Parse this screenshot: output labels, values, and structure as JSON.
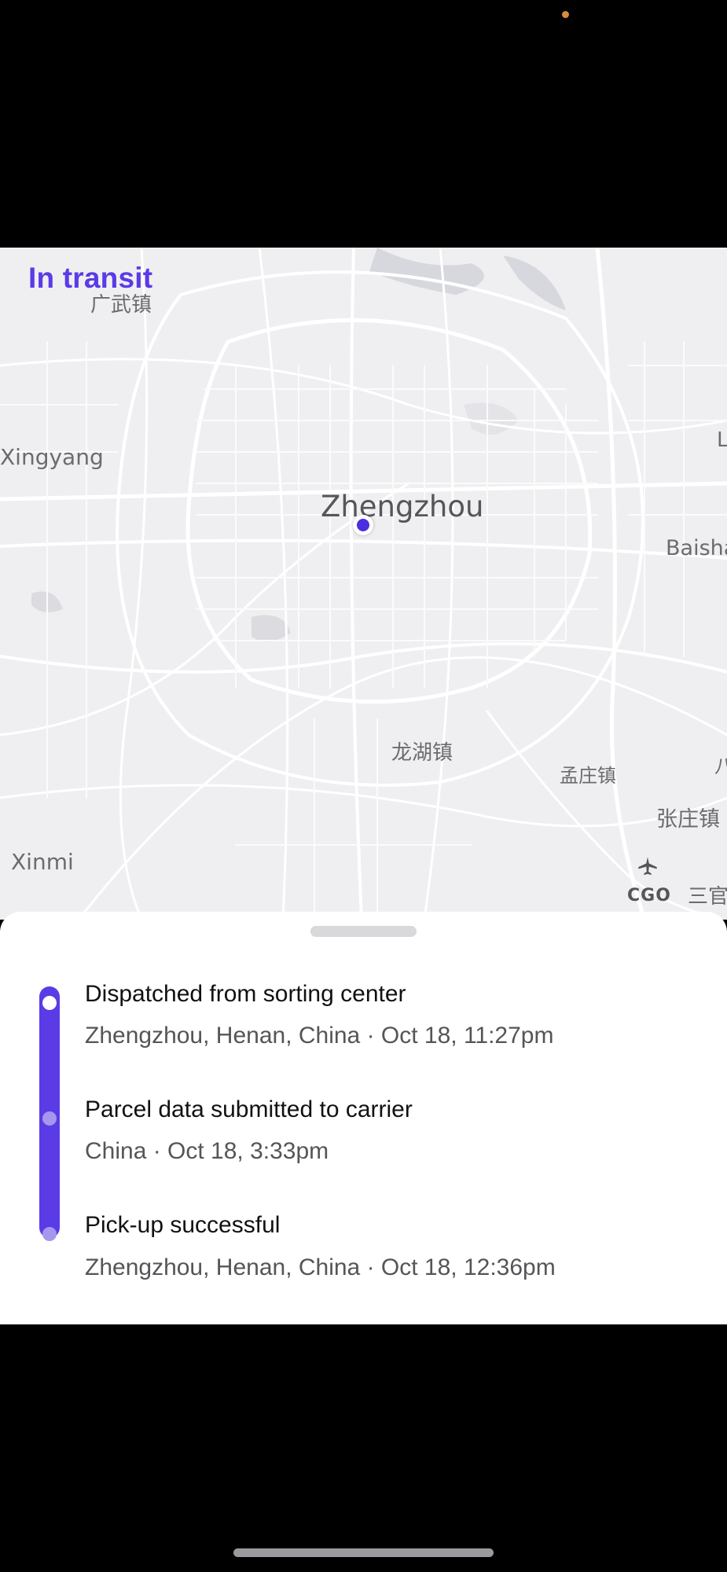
{
  "status": {
    "title": "In transit"
  },
  "map": {
    "labels": {
      "city": "Zhengzhou",
      "xingyang": "Xingyang",
      "baisha": "Baisha",
      "longhu": "龙湖镇",
      "mengzhuang": "孟庄镇",
      "zhangzhuang": "张庄镇",
      "xinmi": "Xinmi",
      "guangwu": "广武镇",
      "airport": "CGO",
      "sanguan": "三官",
      "edge_l": "L",
      "edge_2": "八"
    }
  },
  "events": [
    {
      "title": "Dispatched from sorting center",
      "meta": "Zhengzhou, Henan, China · Oct 18, 11:27pm"
    },
    {
      "title": "Parcel data submitted to carrier",
      "meta": "China · Oct 18, 3:33pm"
    },
    {
      "title": "Pick-up successful",
      "meta": "Zhengzhou, Henan, China · Oct 18, 12:36pm"
    }
  ],
  "colors": {
    "accent": "#5b3be6",
    "map_bg": "#efeff1"
  },
  "icons": {
    "airport": "airplane-icon",
    "location": "location-dot-icon"
  }
}
